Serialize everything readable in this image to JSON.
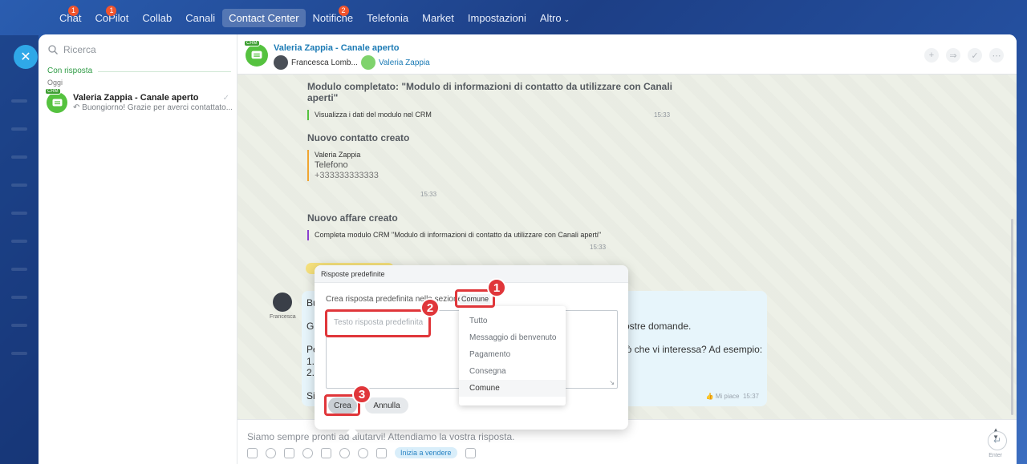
{
  "nav": {
    "items": [
      {
        "label": "Chat",
        "badge": "1"
      },
      {
        "label": "CoPilot",
        "badge": "1"
      },
      {
        "label": "Collab",
        "badge": ""
      },
      {
        "label": "Canali",
        "badge": ""
      },
      {
        "label": "Contact Center",
        "badge": ""
      },
      {
        "label": "Notifiche",
        "badge": "2"
      },
      {
        "label": "Telefonia",
        "badge": ""
      },
      {
        "label": "Market",
        "badge": ""
      },
      {
        "label": "Impostazioni",
        "badge": ""
      },
      {
        "label": "Altro",
        "badge": ""
      }
    ],
    "active": "Contact Center"
  },
  "sidebar": {
    "search_placeholder": "Ricerca",
    "group_label": "Con risposta",
    "sub_label": "Oggi",
    "chat": {
      "crm_tag": "CRM",
      "title": "Valeria Zappia - Canale aperto",
      "preview": "Buongiorno! Grazie per averci contattato..."
    }
  },
  "header": {
    "crm_tag": "CRM",
    "title": "Valeria Zappia - Canale aperto",
    "participant_1": "Francesca Lomb...",
    "participant_2": "Valeria Zappia"
  },
  "messages": {
    "form_completed": {
      "title": "Modulo completato: \"Modulo di informazioni di contatto da utilizzare con Canali aperti\"",
      "line": "Visualizza i dati del modulo nel CRM",
      "time": "15:33"
    },
    "contact_created": {
      "title": "Nuovo contatto creato",
      "name": "Valeria Zappia",
      "phone_label": "Telefono",
      "phone": "+333333333333",
      "time": "15:33"
    },
    "deal_created": {
      "title": "Nuovo affare creato",
      "line": "Completa modulo CRM \"Modulo di informazioni di contatto da utilizzare con Canali aperti\"",
      "time": "15:33"
    },
    "operator_message": {
      "author": "Francesca",
      "line_1": "Bu",
      "line_2": "Gr",
      "line_2_end": "vostre domande.",
      "line_3": "Pe",
      "line_3_end": "ciò che vi interessa? Ad esempio:",
      "line_4": "1.",
      "line_5": "2.",
      "line_6": "Si",
      "like": "Mi piace",
      "time": "15:37"
    }
  },
  "popup": {
    "header": "Risposte predefinite",
    "description": "Crea risposta predefinita nella sezione",
    "category": "Comune",
    "textarea_placeholder": "Testo risposta predefinita",
    "create_label": "Crea",
    "cancel_label": "Annulla"
  },
  "dropdown": {
    "options": [
      "Tutto",
      "Messaggio di benvenuto",
      "Pagamento",
      "Consegna",
      "Comune"
    ],
    "selected": "Comune"
  },
  "callouts": [
    "1",
    "2",
    "3"
  ],
  "input": {
    "text": "Siamo sempre pronti ad aiutarvi! Attendiamo la vostra risposta.",
    "sell_label": "Inizia a vendere",
    "send_hint": "Enter"
  },
  "colors": {
    "accent_green": "#55c23f",
    "highlight_red": "#e0363a",
    "link_blue": "#1c7bb5"
  }
}
